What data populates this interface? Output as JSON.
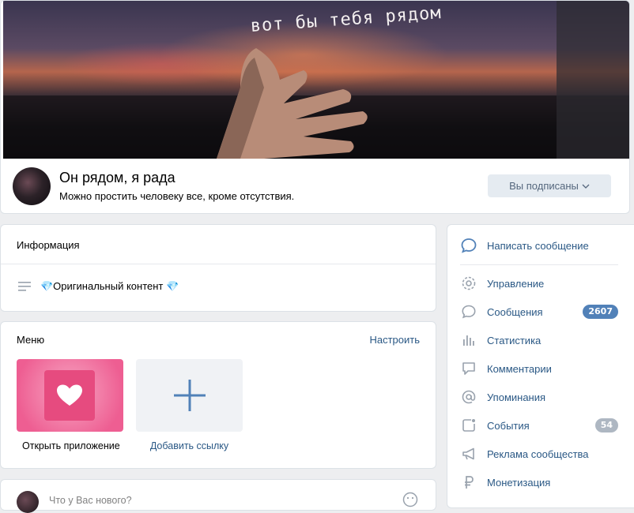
{
  "header": {
    "cover_text": "вот бы тебя рядом",
    "name": "Он рядом, я рада",
    "status": "Можно простить человеку все, кроме отсутствия.",
    "subscribed_label": "Вы подписаны"
  },
  "info": {
    "title": "Информация",
    "text": "💎Оригинальный контент 💎"
  },
  "menu": {
    "title": "Меню",
    "configure": "Настроить",
    "app_label": "Открыть приложение",
    "add_link_label": "Добавить ссылку"
  },
  "post": {
    "placeholder": "Что у Вас нового?"
  },
  "sidebar": {
    "write_message": "Написать сообщение",
    "items": [
      {
        "label": "Управление",
        "icon": "gear-icon",
        "badge": ""
      },
      {
        "label": "Сообщения",
        "icon": "chat-bubble-icon",
        "badge": "2607"
      },
      {
        "label": "Статистика",
        "icon": "stats-bars-icon",
        "badge": ""
      },
      {
        "label": "Комментарии",
        "icon": "comment-icon",
        "badge": ""
      },
      {
        "label": "Упоминания",
        "icon": "at-sign-icon",
        "badge": ""
      },
      {
        "label": "События",
        "icon": "event-icon",
        "badge": "54"
      },
      {
        "label": "Реклама сообщества",
        "icon": "megaphone-icon",
        "badge": ""
      },
      {
        "label": "Монетизация",
        "icon": "ruble-icon",
        "badge": ""
      }
    ]
  },
  "colors": {
    "link": "#2a5885",
    "badge_blue": "#5181b8",
    "badge_gray": "#aeb7c2"
  }
}
